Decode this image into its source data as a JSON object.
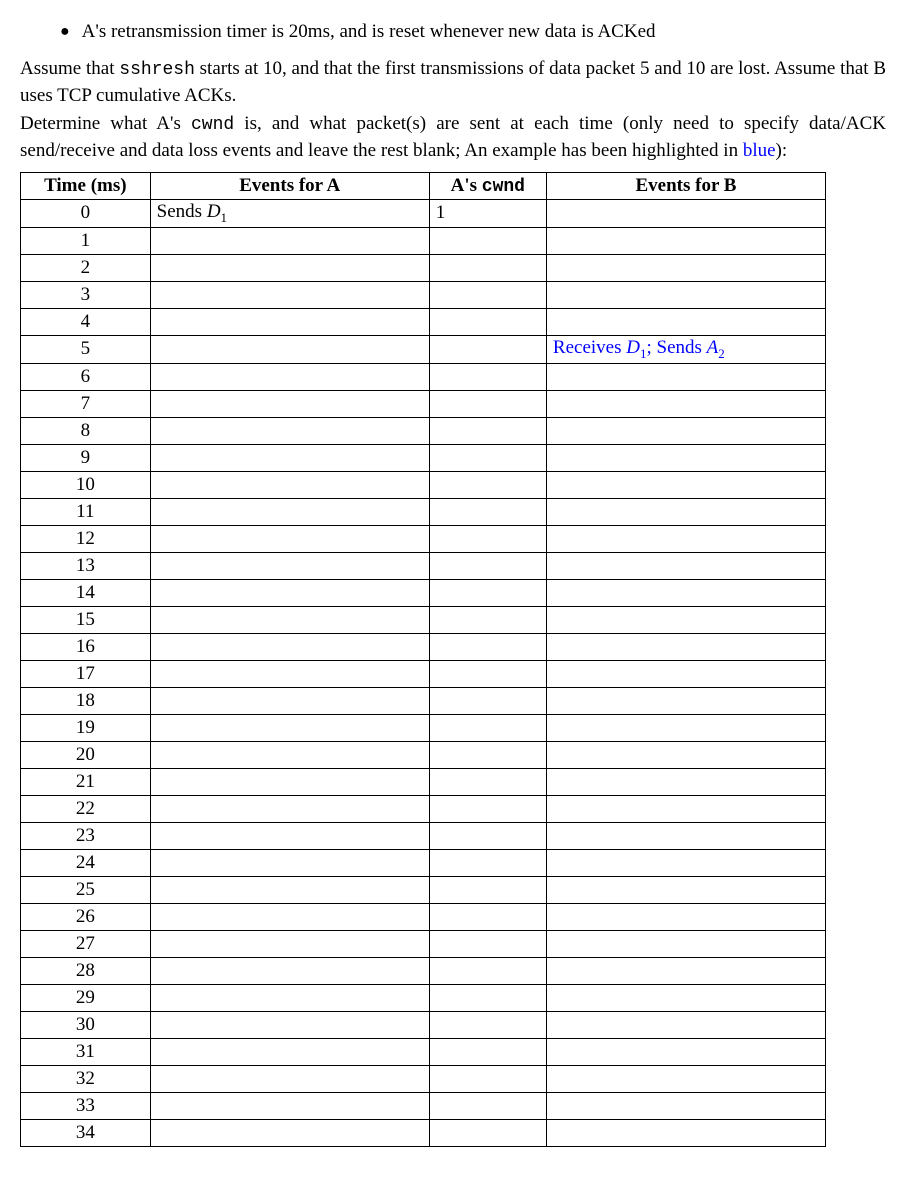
{
  "bullet": {
    "prefix": "A's retransmission timer is 20ms, and is reset whenever new data is ACKed"
  },
  "para1_a": "Assume that ",
  "para1_b": "sshresh",
  "para1_c": " starts at 10, and that the first transmissions of data packet 5 and 10 are lost. Assume that B uses TCP cumulative ACKs.",
  "para2_a": "Determine what A's ",
  "para2_b": "cwnd",
  "para2_c": " is, and what packet(s) are sent at each time (only need to specify data/ACK send/receive and data loss events and leave the rest blank; An example has been highlighted in ",
  "para2_d": "blue",
  "para2_e": "):",
  "headers": {
    "time": "Time (ms)",
    "eventsA": "Events for A",
    "cwnd_a": "A's ",
    "cwnd_b": "cwnd",
    "eventsB": "Events for B"
  },
  "rows": [
    {
      "time": "0",
      "eventsA_pre": "Sends ",
      "eventsA_D": "D",
      "eventsA_sub": "1",
      "cwnd": "1",
      "eventsB": ""
    },
    {
      "time": "1"
    },
    {
      "time": "2"
    },
    {
      "time": "3"
    },
    {
      "time": "4"
    },
    {
      "time": "5",
      "eventsB_recv": "Receives ",
      "eventsB_D": "D",
      "eventsB_Dsub": "1",
      "eventsB_sep": "; Sends ",
      "eventsB_A": "A",
      "eventsB_Asub": "2"
    },
    {
      "time": "6"
    },
    {
      "time": "7"
    },
    {
      "time": "8"
    },
    {
      "time": "9"
    },
    {
      "time": "10"
    },
    {
      "time": "11"
    },
    {
      "time": "12"
    },
    {
      "time": "13"
    },
    {
      "time": "14"
    },
    {
      "time": "15"
    },
    {
      "time": "16"
    },
    {
      "time": "17"
    },
    {
      "time": "18"
    },
    {
      "time": "19"
    },
    {
      "time": "20"
    },
    {
      "time": "21"
    },
    {
      "time": "22"
    },
    {
      "time": "23"
    },
    {
      "time": "24"
    },
    {
      "time": "25"
    },
    {
      "time": "26"
    },
    {
      "time": "27"
    },
    {
      "time": "28"
    },
    {
      "time": "29"
    },
    {
      "time": "30"
    },
    {
      "time": "31"
    },
    {
      "time": "32"
    },
    {
      "time": "33"
    },
    {
      "time": "34"
    }
  ]
}
